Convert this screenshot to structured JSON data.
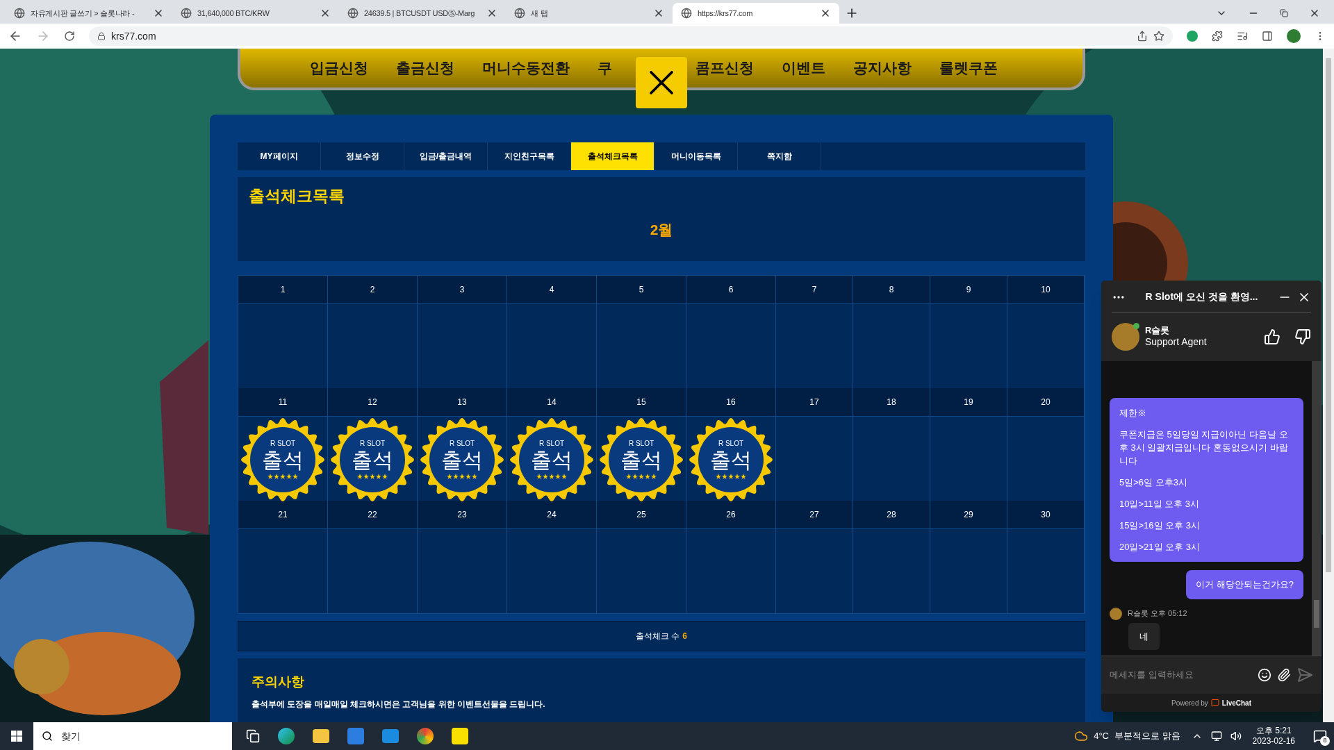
{
  "browser": {
    "tabs": [
      {
        "title": "자유게시판 글쓰기 > 슬롯나라 -",
        "selected": false
      },
      {
        "title": "31,640,000 BTC/KRW",
        "selected": false
      },
      {
        "title": "24639.5 | BTCUSDT USDⓈ-Marg",
        "selected": false
      },
      {
        "title": "새 탭",
        "selected": false
      },
      {
        "title": "https://krs77.com",
        "selected": true
      }
    ],
    "url": "krs77.com"
  },
  "nav": {
    "items": [
      "입금신청",
      "출금신청",
      "머니수동전환",
      "쿠",
      "콤프신청",
      "이벤트",
      "공지사항",
      "룰렛쿠폰"
    ]
  },
  "subtabs": [
    {
      "label": "MY페이지",
      "selected": false
    },
    {
      "label": "정보수정",
      "selected": false
    },
    {
      "label": "입금/출금내역",
      "selected": false
    },
    {
      "label": "지인친구목록",
      "selected": false
    },
    {
      "label": "출석체크목록",
      "selected": true
    },
    {
      "label": "머니이동목록",
      "selected": false
    },
    {
      "label": "쪽지함",
      "selected": false
    }
  ],
  "page_title": "출석체크목록",
  "month": "2월",
  "calendar": {
    "days": [
      {
        "day": "1"
      },
      {
        "day": "2"
      },
      {
        "day": "3"
      },
      {
        "day": "4"
      },
      {
        "day": "5"
      },
      {
        "day": "6"
      },
      {
        "day": "7"
      },
      {
        "day": "8"
      },
      {
        "day": "9"
      },
      {
        "day": "10"
      },
      {
        "day": "11",
        "stamp": {
          "brand": "R SLOT",
          "label": "출석"
        }
      },
      {
        "day": "12",
        "stamp": {
          "brand": "R SLOT",
          "label": "출석"
        }
      },
      {
        "day": "13",
        "stamp": {
          "brand": "R SLOT",
          "label": "출석"
        }
      },
      {
        "day": "14",
        "stamp": {
          "brand": "R SLOT",
          "label": "출석"
        }
      },
      {
        "day": "15",
        "stamp": {
          "brand": "R SLOT",
          "label": "출석"
        }
      },
      {
        "day": "16",
        "stamp": {
          "brand": "R SLOT",
          "label": "출석"
        }
      },
      {
        "day": "17"
      },
      {
        "day": "18"
      },
      {
        "day": "19"
      },
      {
        "day": "20"
      },
      {
        "day": "21"
      },
      {
        "day": "22"
      },
      {
        "day": "23"
      },
      {
        "day": "24"
      },
      {
        "day": "25"
      },
      {
        "day": "26"
      },
      {
        "day": "27"
      },
      {
        "day": "28"
      },
      {
        "day": "29"
      },
      {
        "day": "30"
      }
    ]
  },
  "count": {
    "label": "출석체크 수",
    "value": "6"
  },
  "notice": {
    "title": "주의사항",
    "text": "출석부에 도장을 매일매일 체크하시면은 고객님을 위한 이벤트선물을 드립니다."
  },
  "chat": {
    "title": "R Slot에 오신 것을 환영...",
    "agent": {
      "name": "R슬롯",
      "role": "Support Agent"
    },
    "messages": [
      {
        "kind": "broadcast",
        "paragraphs": [
          "제한※",
          "쿠폰지급은 5일당일 지급이아닌 다음날 오후 3시 일괄지급입니다 혼동없으시기 바랍니다",
          "5일>6일 오후3시",
          "10일>11일 오후 3시",
          "15일>16일 오후 3시",
          "20일>21일 오후 3시"
        ]
      },
      {
        "kind": "visitor",
        "paragraphs": [
          "이거 해당안되는건가요?"
        ]
      },
      {
        "kind": "agent",
        "sender": "R슬롯",
        "time": "오후 05:12",
        "paragraphs": [
          "네"
        ]
      }
    ],
    "placeholder": "메세지를 입력하세요",
    "powered": "Powered by",
    "brand": "LiveChat"
  },
  "taskbar": {
    "search_placeholder": "찾기",
    "temperature": "4°C",
    "weather": "부분적으로 맑음",
    "time": "오후 5:21",
    "date": "2023-02-16",
    "notifications": "8"
  }
}
